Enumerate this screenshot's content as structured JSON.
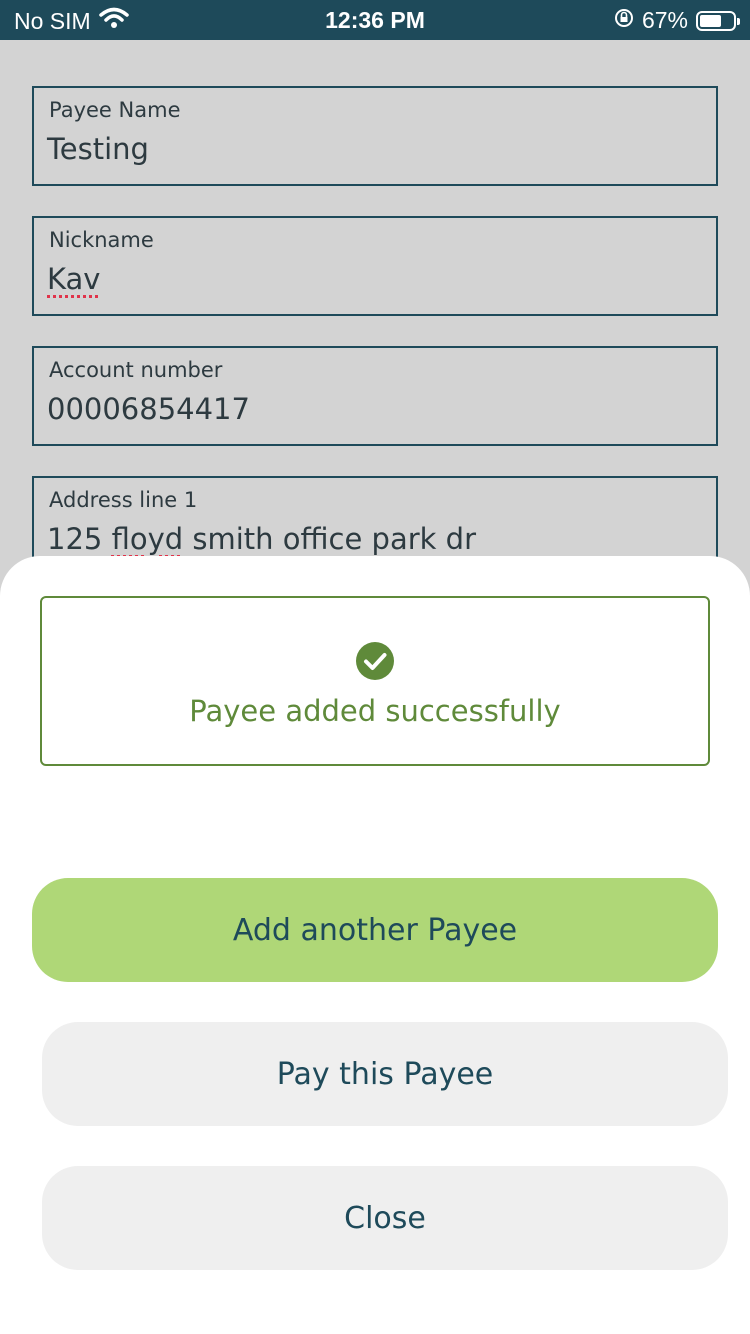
{
  "status_bar": {
    "carrier": "No SIM",
    "time": "12:36 PM",
    "battery_percent": "67%",
    "battery_level": 0.67,
    "icons": [
      "wifi-icon",
      "orientation-lock-icon",
      "battery-icon"
    ]
  },
  "form": {
    "fields": [
      {
        "label": "Payee Name",
        "value": "Testing"
      },
      {
        "label": "Nickname",
        "value": "Kav"
      },
      {
        "label": "Account number",
        "value": "00006854417"
      },
      {
        "label": "Address line 1",
        "value_before": "125 ",
        "value_misspelled": "floyd",
        "value_after": " smith office park dr"
      }
    ]
  },
  "sheet": {
    "success_icon": "check-circle-icon",
    "success_message": "Payee added successfully",
    "buttons": {
      "add_another": "Add another Payee",
      "pay_this": "Pay this Payee",
      "close": "Close"
    }
  },
  "colors": {
    "status_bar_bg": "#1e4a5a",
    "success_green": "#5f8a3a",
    "primary_button": "#afd777",
    "secondary_button": "#efefef",
    "text_dark": "#1e4a5a"
  }
}
